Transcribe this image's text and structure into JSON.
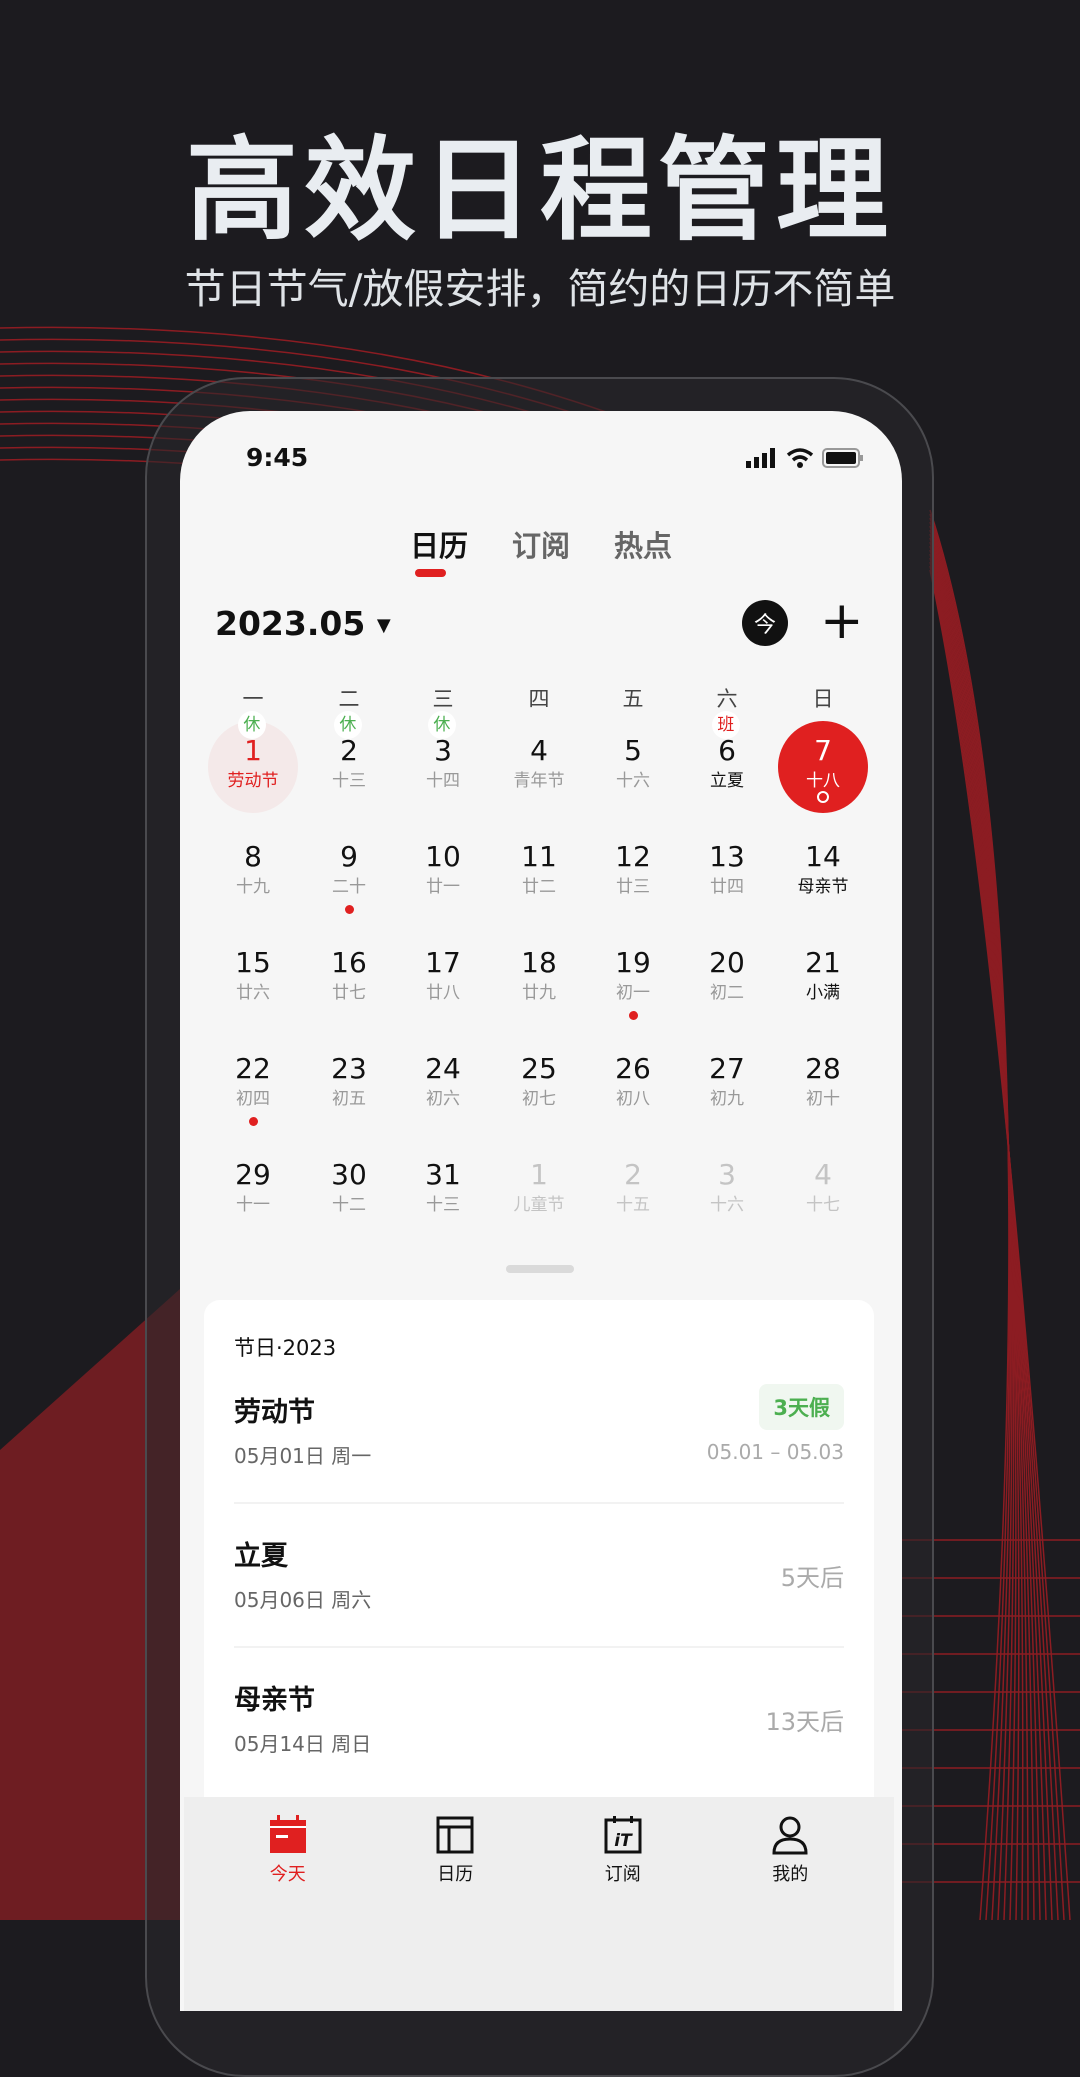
{
  "promo": {
    "title": "高效日程管理",
    "subtitle": "节日节气/放假安排，简约的日历不简单"
  },
  "status_bar": {
    "time": "9:45"
  },
  "tabs": [
    {
      "label": "日历",
      "active": true
    },
    {
      "label": "订阅"
    },
    {
      "label": "热点"
    }
  ],
  "calendar": {
    "month": "2023.05",
    "today_label": "今",
    "weekdays": [
      "一",
      "二",
      "三",
      "四",
      "五",
      "六",
      "日"
    ],
    "rows": [
      [
        {
          "d": "1",
          "l": "劳动节",
          "badge": "休",
          "dot": true,
          "holiday": true
        },
        {
          "d": "2",
          "l": "十三",
          "badge": "休"
        },
        {
          "d": "3",
          "l": "十四",
          "badge": "休"
        },
        {
          "d": "4",
          "l": "青年节"
        },
        {
          "d": "5",
          "l": "十六"
        },
        {
          "d": "6",
          "l": "立夏",
          "badge": "班",
          "hl": true
        },
        {
          "d": "7",
          "l": "十八",
          "selected": true,
          "dot": true
        }
      ],
      [
        {
          "d": "8",
          "l": "十九"
        },
        {
          "d": "9",
          "l": "二十",
          "dot": true
        },
        {
          "d": "10",
          "l": "廿一"
        },
        {
          "d": "11",
          "l": "廿二"
        },
        {
          "d": "12",
          "l": "廿三"
        },
        {
          "d": "13",
          "l": "廿四"
        },
        {
          "d": "14",
          "l": "母亲节",
          "hl": true
        }
      ],
      [
        {
          "d": "15",
          "l": "廿六"
        },
        {
          "d": "16",
          "l": "廿七"
        },
        {
          "d": "17",
          "l": "廿八"
        },
        {
          "d": "18",
          "l": "廿九"
        },
        {
          "d": "19",
          "l": "初一",
          "dot": true
        },
        {
          "d": "20",
          "l": "初二"
        },
        {
          "d": "21",
          "l": "小满",
          "hl": true
        }
      ],
      [
        {
          "d": "22",
          "l": "初四",
          "dot": true
        },
        {
          "d": "23",
          "l": "初五"
        },
        {
          "d": "24",
          "l": "初六"
        },
        {
          "d": "25",
          "l": "初七"
        },
        {
          "d": "26",
          "l": "初八"
        },
        {
          "d": "27",
          "l": "初九"
        },
        {
          "d": "28",
          "l": "初十"
        }
      ],
      [
        {
          "d": "29",
          "l": "十一"
        },
        {
          "d": "30",
          "l": "十二"
        },
        {
          "d": "31",
          "l": "十三"
        },
        {
          "d": "1",
          "l": "儿童节",
          "other": true
        },
        {
          "d": "2",
          "l": "十五",
          "other": true
        },
        {
          "d": "3",
          "l": "十六",
          "other": true
        },
        {
          "d": "4",
          "l": "十七",
          "other": true
        }
      ]
    ]
  },
  "festivals": {
    "title": "节日·2023",
    "items": [
      {
        "name": "劳动节",
        "date": "05月01日 周一",
        "tag": "3天假",
        "range": "05.01 – 05.03"
      },
      {
        "name": "立夏",
        "date": "05月06日 周六",
        "right": "5天后"
      },
      {
        "name": "母亲节",
        "date": "05月14日 周日",
        "right": "13天后"
      }
    ]
  },
  "bottom_nav": [
    {
      "label": "今天",
      "icon": "calendar-today-icon",
      "active": true
    },
    {
      "label": "日历",
      "icon": "layout-icon"
    },
    {
      "label": "订阅",
      "icon": "subscribe-icon"
    },
    {
      "label": "我的",
      "icon": "user-icon"
    }
  ],
  "colors": {
    "accent": "#e02020",
    "rest": "#4caf50",
    "background": "#1c1b1f"
  }
}
